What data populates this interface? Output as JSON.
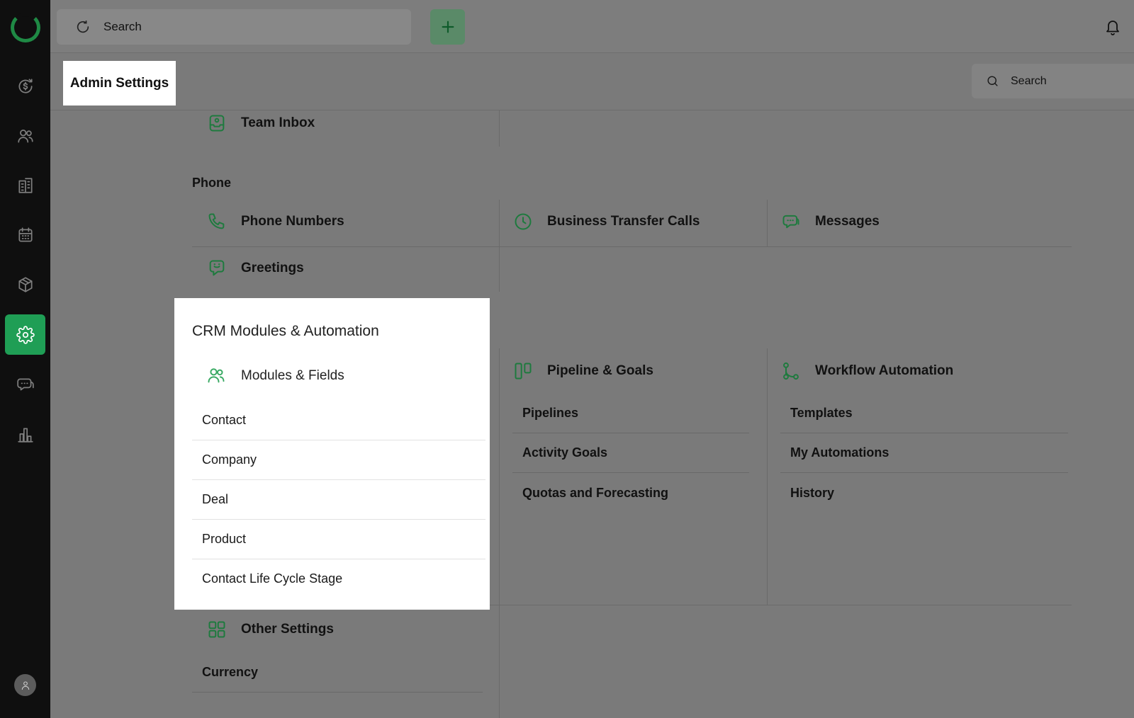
{
  "topbar": {
    "search_placeholder": "Search"
  },
  "header": {
    "title": "Admin Settings",
    "search_placeholder": "Search"
  },
  "rail": {
    "items": [
      "deals-icon",
      "contacts-icon",
      "companies-icon",
      "calendar-icon",
      "products-icon",
      "settings-icon",
      "messages-icon",
      "reports-icon"
    ],
    "active": "settings-icon",
    "accent": "#1f9e55"
  },
  "sections": {
    "team_inbox": "Team Inbox",
    "phone": {
      "label": "Phone",
      "items": [
        "Phone Numbers",
        "Business Transfer Calls",
        "Messages",
        "Greetings"
      ]
    },
    "crm": {
      "title": "CRM Modules & Automation",
      "modules": {
        "label": "Modules & Fields",
        "items": [
          "Contact",
          "Company",
          "Deal",
          "Product",
          "Contact Life Cycle Stage"
        ]
      },
      "pipeline": {
        "label": "Pipeline & Goals",
        "items": [
          "Pipelines",
          "Activity Goals",
          "Quotas and Forecasting"
        ]
      },
      "workflow": {
        "label": "Workflow Automation",
        "items": [
          "Templates",
          "My Automations",
          "History"
        ]
      }
    },
    "other": {
      "label": "Other Settings",
      "items": [
        "Currency"
      ]
    }
  }
}
